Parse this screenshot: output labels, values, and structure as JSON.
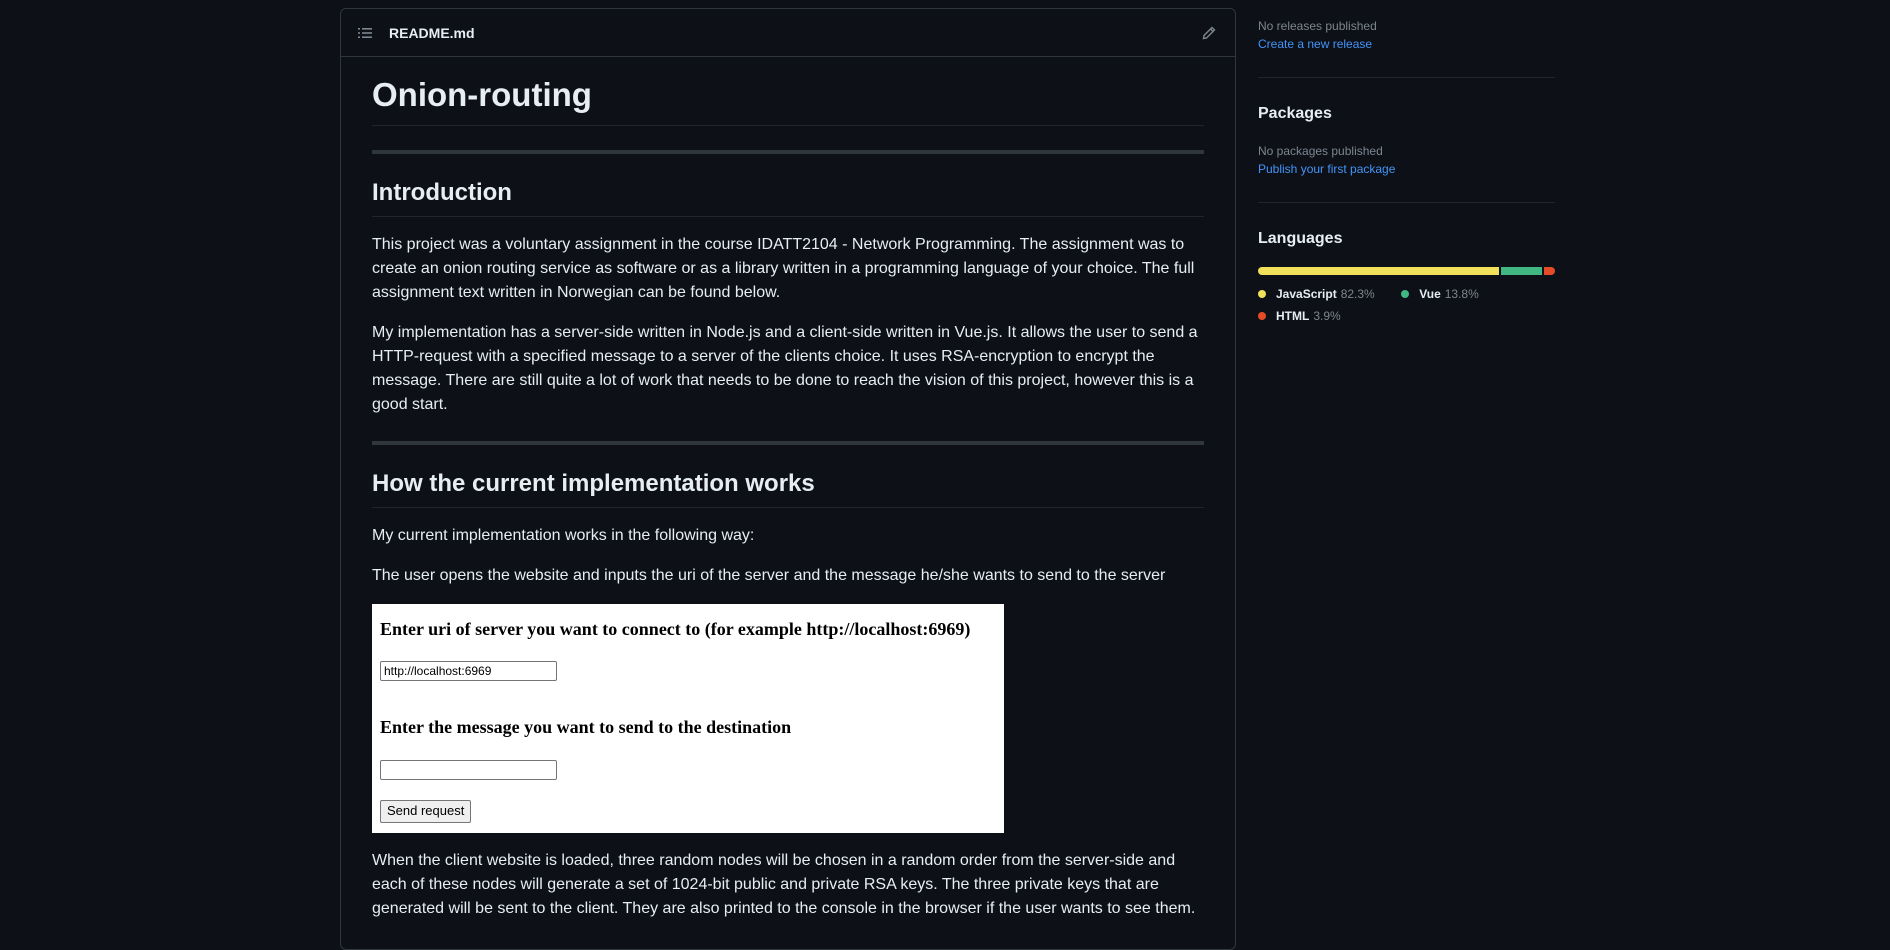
{
  "readme": {
    "filename": "README.md",
    "toc_icon": "list-unordered-icon",
    "edit_icon": "pencil-icon"
  },
  "content": {
    "title": "Onion-routing",
    "intro_heading": "Introduction",
    "intro_p1": "This project was a voluntary assignment in the course IDATT2104 - Network Programming. The assignment was to create an onion routing service as software or as a library written in a programming language of your choice. The full assignment text written in Norwegian can be found below.",
    "intro_p2": "My implementation has a server-side written in Node.js and a client-side written in Vue.js. It allows the user to send a HTTP-request with a specified message to a server of the clients choice. It uses RSA-encryption to encrypt the message. There are still quite a lot of work that needs to be done to reach the vision of this project, however this is a good start.",
    "how_heading": "How the current implementation works",
    "how_p1": "My current implementation works in the following way:",
    "how_p2": "The user opens the website and inputs the uri of the server and the message he/she wants to send to the server",
    "how_p3": "When the client website is loaded, three random nodes will be chosen in a random order from the server-side and each of these nodes will generate a set of 1024-bit public and private RSA keys. The three private keys that are generated will be sent to the client. They are also printed to the console in the browser if the user wants to see them."
  },
  "demo": {
    "uri_heading": "Enter uri of server you want to connect to (for example http://localhost:6969)",
    "uri_value": "http://localhost:6969",
    "message_heading": "Enter the message you want to send to the destination",
    "message_value": "",
    "send_label": "Send request"
  },
  "sidebar": {
    "releases_text": "No releases published",
    "releases_link": "Create a new release",
    "packages_heading": "Packages",
    "packages_text": "No packages published",
    "packages_link": "Publish your first package",
    "languages_heading": "Languages",
    "languages": [
      {
        "name": "JavaScript",
        "percent": "82.3%",
        "value": 82.3,
        "color": "#f1e05a"
      },
      {
        "name": "Vue",
        "percent": "13.8%",
        "value": 13.8,
        "color": "#41b883"
      },
      {
        "name": "HTML",
        "percent": "3.9%",
        "value": 3.9,
        "color": "#e34c26"
      }
    ]
  }
}
